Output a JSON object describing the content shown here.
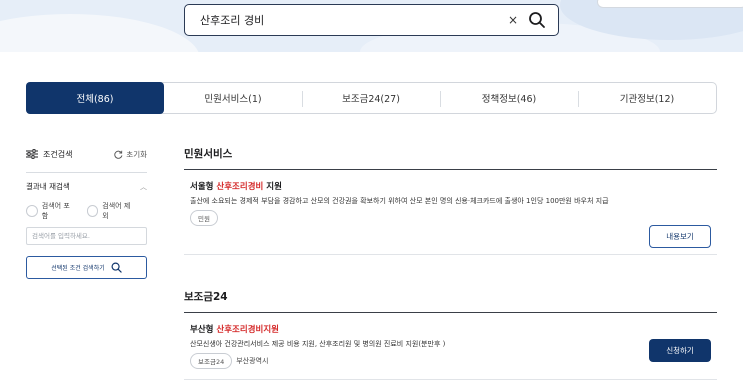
{
  "search": {
    "query": "산후조리 경비",
    "clear_icon": "×"
  },
  "tabs": [
    {
      "label": "전체(86)",
      "active": true
    },
    {
      "label": "민원서비스(1)",
      "active": false
    },
    {
      "label": "보조금24(27)",
      "active": false
    },
    {
      "label": "정책정보(46)",
      "active": false
    },
    {
      "label": "기관정보(12)",
      "active": false
    }
  ],
  "filter": {
    "title": "조건검색",
    "reset_label": "초기화",
    "subsection": "결과내 재검색",
    "include_label": "검색어 포함",
    "exclude_label": "검색어 제외",
    "input_placeholder": "검색어를 입력하세요.",
    "apply_label": "선택된 조건 검색하기"
  },
  "sections": {
    "civil": {
      "title": "민원서비스",
      "item": {
        "title_prefix": "서울형 ",
        "title_highlight": "산후조리경비",
        "title_suffix": " 지원",
        "description": "출산에 소요되는 경제적 부담을 경감하고 산모의 건강권을 확보하기 위하여 산모 본인 명의 신용·체크카드에 출생아 1인당 100만원 바우처 지급",
        "tag": "민원",
        "action": "내용보기"
      }
    },
    "subsidy": {
      "title": "보조금24",
      "item": {
        "title_prefix": "부산형 ",
        "title_highlight": "산후조리경비지원",
        "description": "산모신생아 건강관리서비스 제공 비용 지원, 산후조리원 및 병의원 진료비 지원(분만후 )",
        "tag": "보조금24",
        "org": "부산광역시",
        "action": "신청하기"
      }
    }
  },
  "colors": {
    "primary": "#10356b",
    "highlight": "#d52b2b",
    "hero": "#e6eef8"
  }
}
